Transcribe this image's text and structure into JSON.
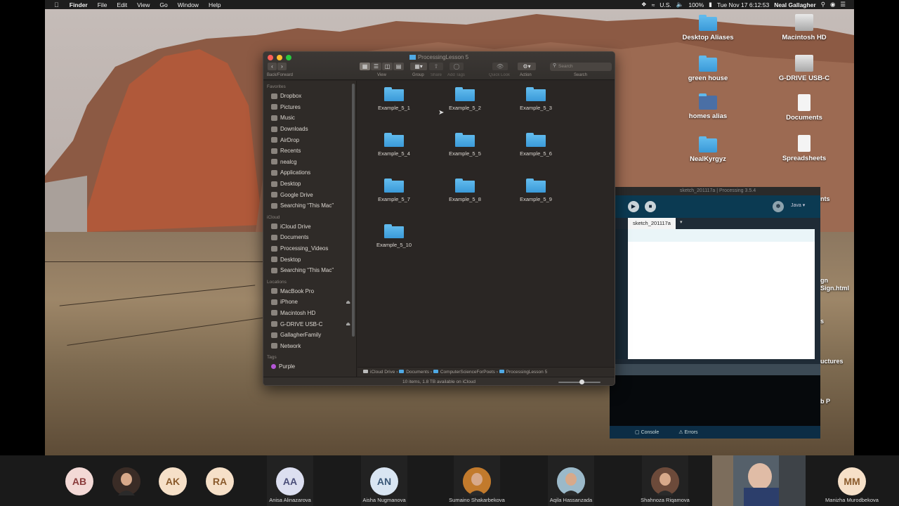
{
  "menubar": {
    "apple": "",
    "app": "Finder",
    "items": [
      "File",
      "Edit",
      "View",
      "Go",
      "Window",
      "Help"
    ],
    "input_source": "U.S.",
    "battery": "100%",
    "datetime": "Tue Nov 17  6:12:53",
    "user": "Neal Gallagher"
  },
  "desktop_icons": [
    {
      "label": "Desktop Aliases",
      "kind": "folder"
    },
    {
      "label": "Macintosh HD",
      "kind": "drive"
    },
    {
      "label": "green house",
      "kind": "folder"
    },
    {
      "label": "G-DRIVE USB-C",
      "kind": "drive"
    },
    {
      "label": "homes alias",
      "kind": "folder-people"
    },
    {
      "label": "Documents",
      "kind": "doc"
    },
    {
      "label": "NealKyrgyz",
      "kind": "folder"
    },
    {
      "label": "Spreadsheets",
      "kind": "doc"
    }
  ],
  "partial_desktop_labels": [
    "nts",
    "gn",
    "Sign.html",
    "s",
    "uctures",
    "b P"
  ],
  "finder": {
    "title": "ProcessingLesson 5",
    "toolbar": {
      "nav_label": "Back/Forward",
      "view_label": "View",
      "group_label": "Group",
      "share_label": "Share",
      "tags_label": "Add Tags",
      "quicklook_label": "Quick Look",
      "action_label": "Action",
      "search_label": "Search",
      "search_placeholder": "Search"
    },
    "sidebar": {
      "favorites_head": "Favorites",
      "favorites": [
        "Dropbox",
        "Pictures",
        "Music",
        "Downloads",
        "AirDrop",
        "Recents",
        "nealcg",
        "Applications",
        "Desktop",
        "Google Drive",
        "Searching “This Mac”"
      ],
      "icloud_head": "iCloud",
      "icloud": [
        "iCloud Drive",
        "Documents",
        "Processing_Videos",
        "Desktop",
        "Searching “This Mac”"
      ],
      "locations_head": "Locations",
      "locations": [
        {
          "label": "MacBook Pro",
          "eject": ""
        },
        {
          "label": "iPhone",
          "eject": "⏏"
        },
        {
          "label": "Macintosh HD",
          "eject": ""
        },
        {
          "label": "G-DRIVE USB-C",
          "eject": "⏏"
        },
        {
          "label": "GallagherFamily",
          "eject": ""
        },
        {
          "label": "Network",
          "eject": ""
        }
      ],
      "tags_head": "Tags",
      "tags": [
        {
          "label": "Purple",
          "color": "#b455d6"
        }
      ]
    },
    "items": [
      "Example_5_1",
      "Example_5_2",
      "Example_5_3",
      "Example_5_4",
      "Example_5_5",
      "Example_5_6",
      "Example_5_7",
      "Example_5_8",
      "Example_5_9",
      "Example_5_10"
    ],
    "path": [
      "iCloud Drive",
      "Documents",
      "ComputerScienceForPoets",
      "ProcessingLesson 5"
    ],
    "status": "10 items, 1.8 TB available on iCloud"
  },
  "processing": {
    "title": "sketch_201117a | Processing 3.5.4",
    "mode": "Java ▾",
    "tab": "sketch_201117a",
    "tab_arrow": "▾",
    "console_tab": "Console",
    "errors_tab": "Errors"
  },
  "participants": [
    {
      "initials": "AB",
      "name": "",
      "bg": "#f3d9d6",
      "fg": "#8a3b3b",
      "photo": false
    },
    {
      "initials": "",
      "name": "",
      "bg": "#3a2c26",
      "fg": "#fff",
      "photo": true
    },
    {
      "initials": "AK",
      "name": "",
      "bg": "#f6e0c8",
      "fg": "#8a5a2b",
      "photo": false
    },
    {
      "initials": "RA",
      "name": "",
      "bg": "#f6e0c8",
      "fg": "#8a5a2b",
      "photo": false
    },
    {
      "initials": "AA",
      "name": "Anisa Alinazarova",
      "bg": "#dcdff0",
      "fg": "#4b4f7a",
      "photo": false
    },
    {
      "initials": "AN",
      "name": "Aisha Nugmanova",
      "bg": "#d9e5f2",
      "fg": "#3b5878",
      "photo": false
    },
    {
      "initials": "",
      "name": "Sumaino Shakarbekova",
      "bg": "#c27a2c",
      "fg": "#fff",
      "photo": true
    },
    {
      "initials": "",
      "name": "Aqila Hassanzada",
      "bg": "#9bb9c9",
      "fg": "#fff",
      "photo": true
    },
    {
      "initials": "",
      "name": "Shahnoza Riqamova",
      "bg": "#6c4a3a",
      "fg": "#fff",
      "photo": true
    },
    {
      "initials": "MM",
      "name": "Manizha Murodbekova",
      "bg": "#f6e0c8",
      "fg": "#8a5a2b",
      "photo": false
    }
  ]
}
